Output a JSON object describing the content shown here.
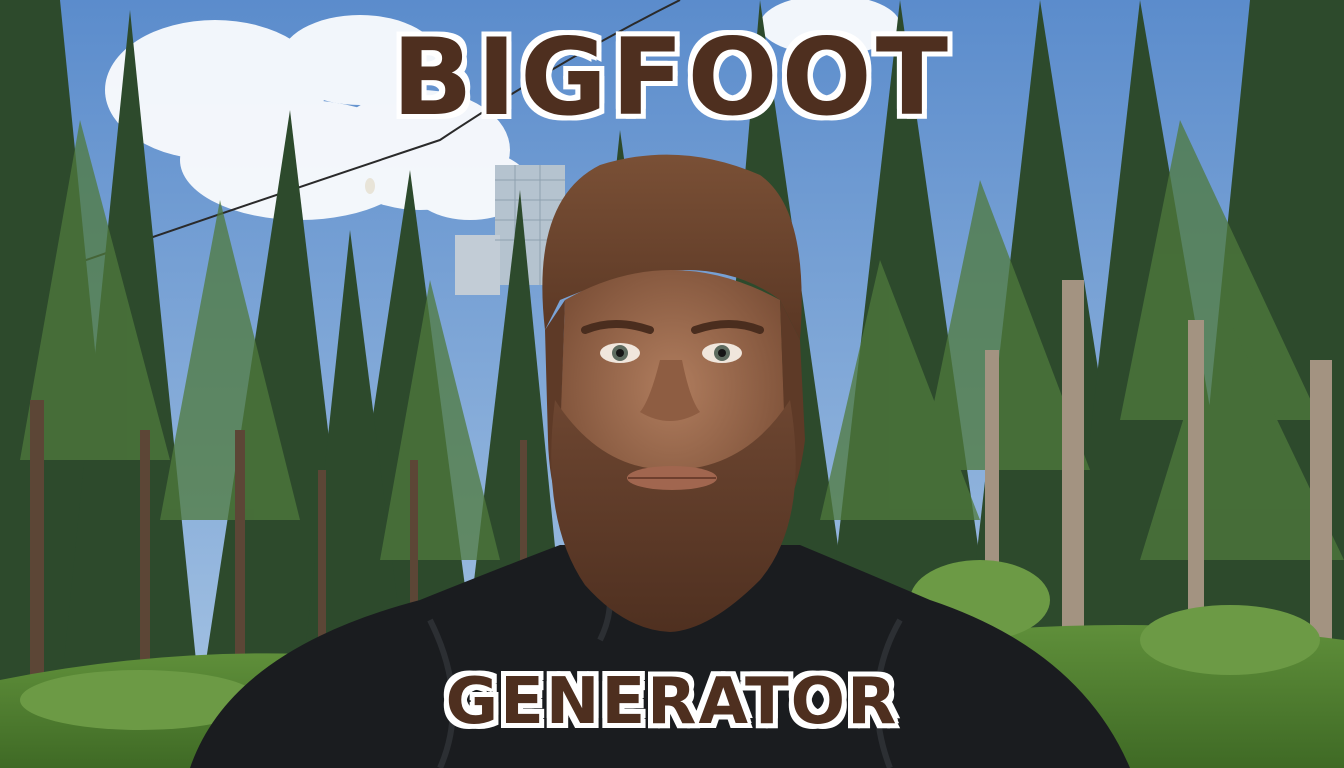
{
  "overlay": {
    "title_top": "BIGFOOT",
    "title_bottom": "GENERATOR"
  },
  "colors": {
    "title_fill": "#4e2f1f",
    "title_outline": "#ffffff",
    "sky": "#6f9ac9",
    "forest_dark": "#1f3a24",
    "fur": "#6b4530"
  }
}
